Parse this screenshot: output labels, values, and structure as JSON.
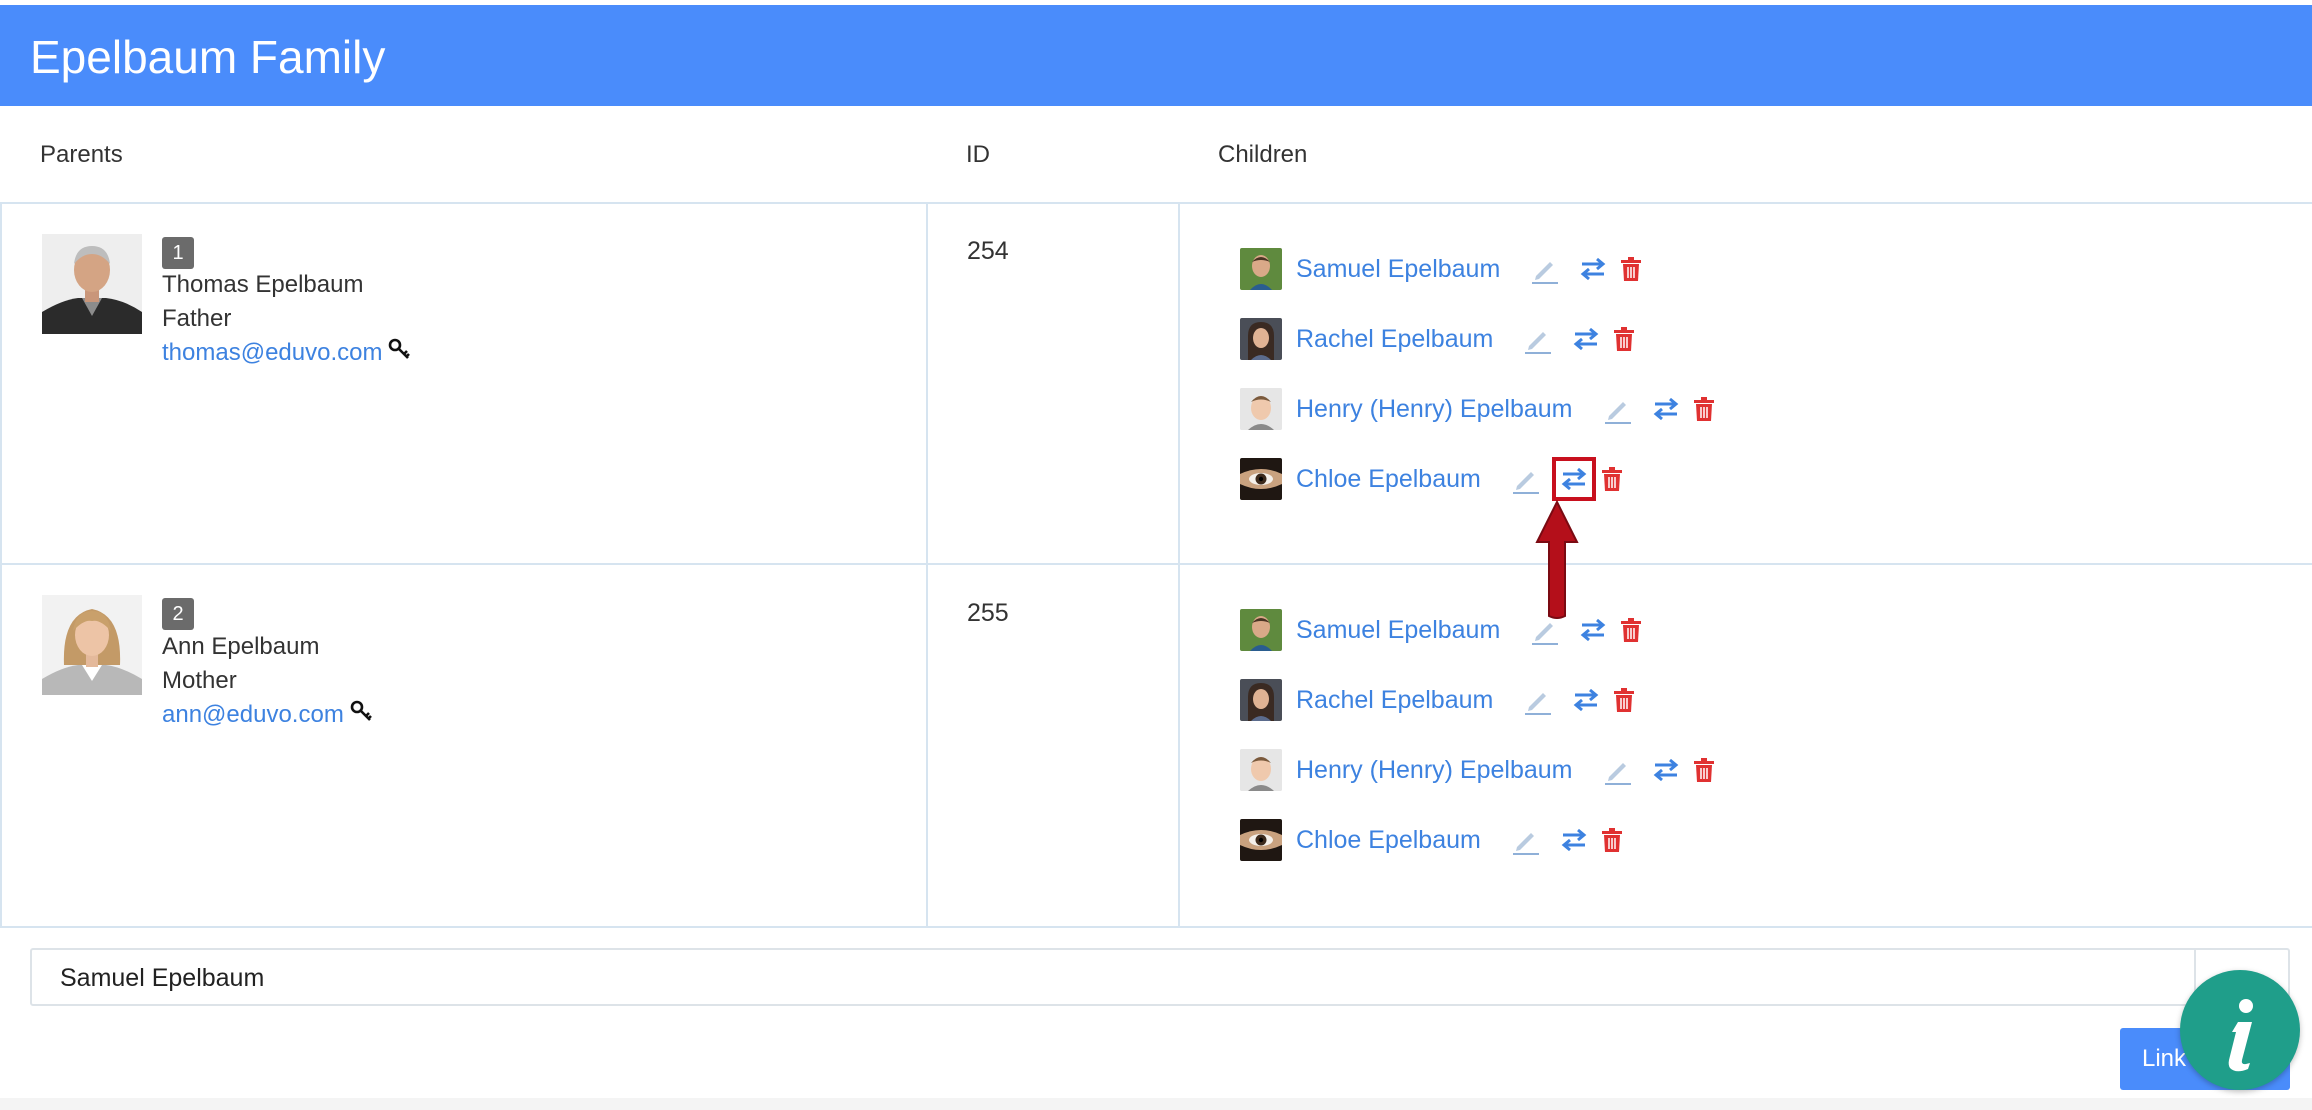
{
  "header": {
    "title": "Epelbaum Family"
  },
  "columns": {
    "parents": "Parents",
    "id": "ID",
    "children": "Children"
  },
  "families": [
    {
      "badge": "1",
      "name": "Thomas Epelbaum",
      "role": "Father",
      "email": "thomas@eduvo.com",
      "id": "254",
      "children": [
        {
          "name": "Samuel Epelbaum"
        },
        {
          "name": "Rachel Epelbaum"
        },
        {
          "name": "Henry (Henry) Epelbaum"
        },
        {
          "name": "Chloe Epelbaum"
        }
      ]
    },
    {
      "badge": "2",
      "name": "Ann Epelbaum",
      "role": "Mother",
      "email": "ann@eduvo.com",
      "id": "255",
      "children": [
        {
          "name": "Samuel Epelbaum"
        },
        {
          "name": "Rachel Epelbaum"
        },
        {
          "name": "Henry (Henry) Epelbaum"
        },
        {
          "name": "Chloe Epelbaum"
        }
      ]
    }
  ],
  "search": {
    "value": "Samuel Epelbaum"
  },
  "link_button": {
    "label": "Link"
  },
  "colors": {
    "header": "#4a8cfb",
    "link": "#3d82e0",
    "delete": "#e03131",
    "highlight": "#c8101e",
    "info": "#1f9e8a"
  },
  "icons": {
    "edit": "pencil-icon",
    "swap": "swap-arrows-icon",
    "delete": "trash-icon",
    "key": "key-icon",
    "info": "info-icon"
  }
}
